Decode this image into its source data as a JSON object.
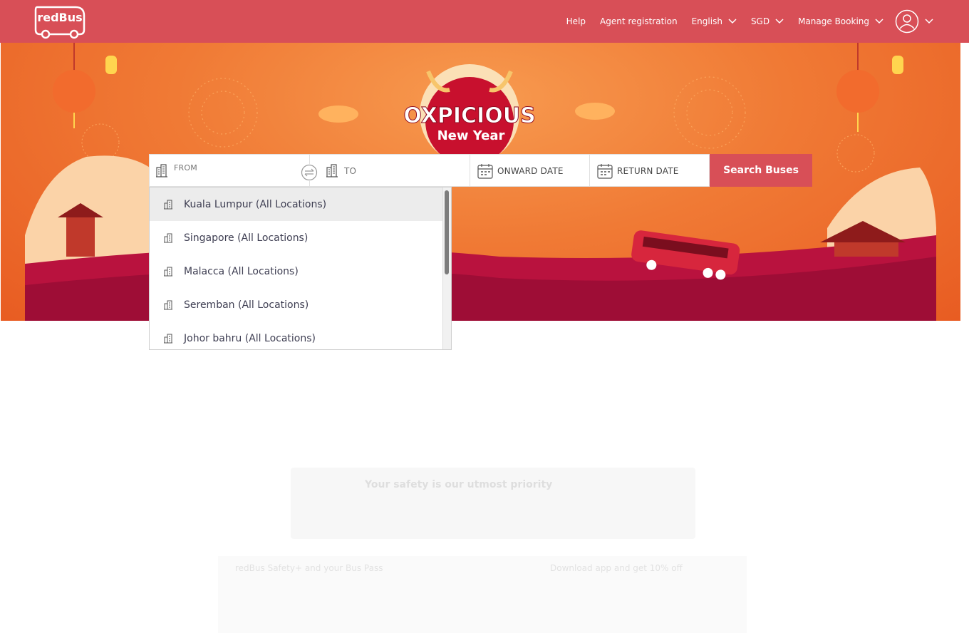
{
  "header": {
    "logo_text": "redBus",
    "nav": {
      "help": "Help",
      "agent": "Agent registration",
      "language": "English",
      "currency": "SGD",
      "manage": "Manage Booking"
    }
  },
  "banner": {
    "title_line1": "OXPICIOUS",
    "title_line2": "New Year"
  },
  "search": {
    "from_label": "FROM",
    "to_label": "TO",
    "onward_label": "ONWARD DATE",
    "return_label": "RETURN DATE",
    "button_label": "Search Buses"
  },
  "dropdown": {
    "items": [
      "Kuala Lumpur (All Locations)",
      "Singapore (All Locations)",
      "Malacca (All Locations)",
      "Seremban (All Locations)",
      "Johor bahru (All Locations)"
    ]
  },
  "faded": {
    "safety_title": "Your safety is our utmost priority",
    "left_title": "redBus Safety+ and your Bus Pass",
    "right_title": "Download app and get 10% off"
  },
  "colors": {
    "brand": "#d84f57",
    "banner": "#f07a35"
  }
}
